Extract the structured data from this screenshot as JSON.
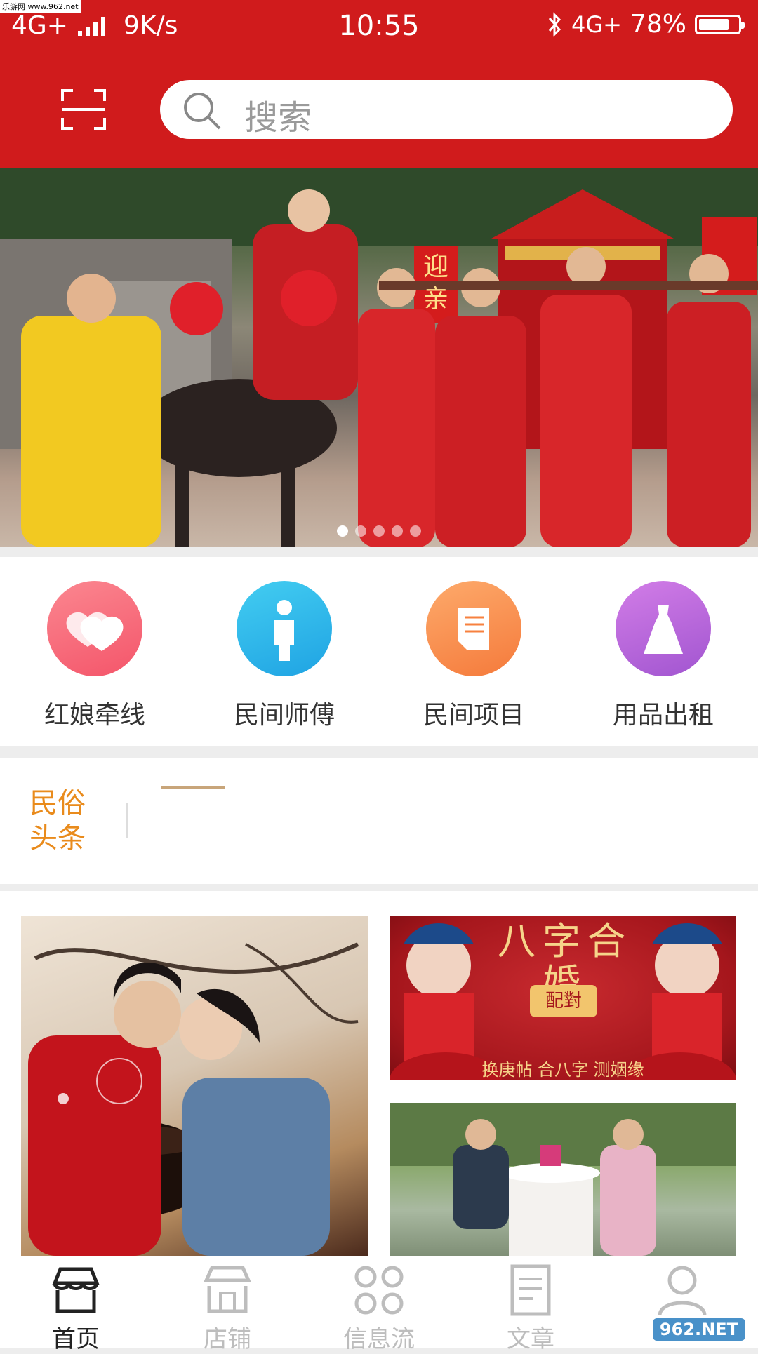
{
  "status_bar": {
    "network_left": "4G+",
    "speed": "9K/s",
    "time": "10:55",
    "network_right": "4G+",
    "battery": "78%",
    "battery_level": 0.78
  },
  "header": {
    "search_placeholder": "搜索"
  },
  "banner": {
    "slide_count": 5,
    "active_slide": 1,
    "sign_text": "迎亲"
  },
  "categories": [
    {
      "label": "红娘牵线",
      "icon": "hearts-icon",
      "color_from": "#fb7f87",
      "color_to": "#f55c6a"
    },
    {
      "label": "民间师傅",
      "icon": "person-icon",
      "color_from": "#3fc6ee",
      "color_to": "#23a9e6"
    },
    {
      "label": "民间项目",
      "icon": "document-icon",
      "color_from": "#fca365",
      "color_to": "#f7813f"
    },
    {
      "label": "用品出租",
      "icon": "dress-icon",
      "color_from": "#cf77e5",
      "color_to": "#a458d2"
    }
  ],
  "news": {
    "tag_line1": "民俗",
    "tag_line2": "头条"
  },
  "promos": {
    "b_title": "八字合婚",
    "b_badge": "配對",
    "b_subtitle": "换庚帖 合八字 测姻缘"
  },
  "tabbar": [
    {
      "label": "首页",
      "active": true,
      "icon": "store-icon"
    },
    {
      "label": "店铺",
      "active": false,
      "icon": "shop-icon"
    },
    {
      "label": "信息流",
      "active": false,
      "icon": "grid-icon"
    },
    {
      "label": "文章",
      "active": false,
      "icon": "article-icon"
    },
    {
      "label": "",
      "active": false,
      "icon": "user-icon"
    }
  ],
  "watermarks": {
    "top_left": "乐游网 www.962.net",
    "bottom_right": "962.NET"
  },
  "colors": {
    "brand_red": "#d01b1c",
    "news_tag": "#e98b1c"
  }
}
